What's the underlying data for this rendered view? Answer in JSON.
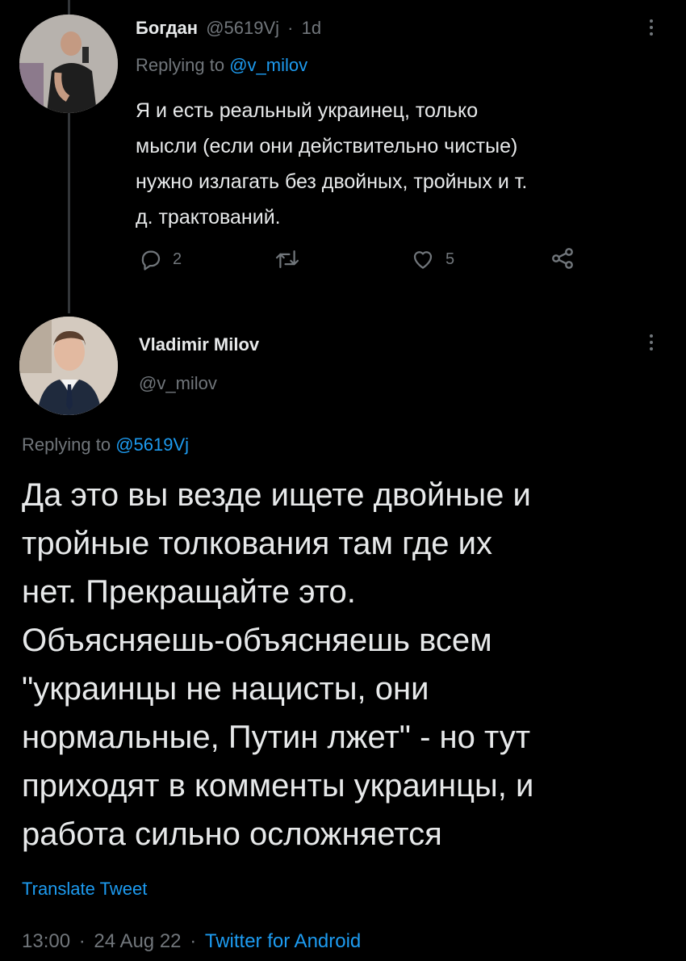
{
  "reply_tweet": {
    "author_name": "Богдан",
    "author_handle": "@5619Vj",
    "separator": "·",
    "time_ago": "1d",
    "replying_prefix": "Replying to",
    "replying_to": "@v_milov",
    "text_lines": [
      "Я и есть реальный украинец, только",
      "мысли (если они действительно чистые)",
      "нужно излагать без двойных, тройных и т.",
      "д. трактований."
    ],
    "reply_count": "2",
    "like_count": "5",
    "icons": [
      "more-icon",
      "reply-icon",
      "retweet-icon",
      "like-icon",
      "share-icon"
    ]
  },
  "main_tweet": {
    "author_name": "Vladimir Milov",
    "author_handle": "@v_milov",
    "replying_prefix": "Replying to",
    "replying_to": "@5619Vj",
    "text_lines": [
      "Да это вы везде ищете двойные и",
      "тройные толкования там где их",
      "нет. Прекращайте это.",
      "Объясняешь-объясняешь всем",
      "\"украинцы не нацисты, они",
      "нормальные, Путин лжет\" - но тут",
      "приходят в комменты украинцы, и",
      "работа сильно осложняется"
    ],
    "translate_label": "Translate Tweet",
    "time": "13:00",
    "date": "24 Aug 22",
    "separator": "·",
    "source": "Twitter for Android",
    "icons": [
      "more-icon"
    ]
  },
  "colors": {
    "background": "#000000",
    "text": "#e7e9ea",
    "muted": "#71767b",
    "accent": "#1d9bf0",
    "thread_line": "#333639"
  }
}
